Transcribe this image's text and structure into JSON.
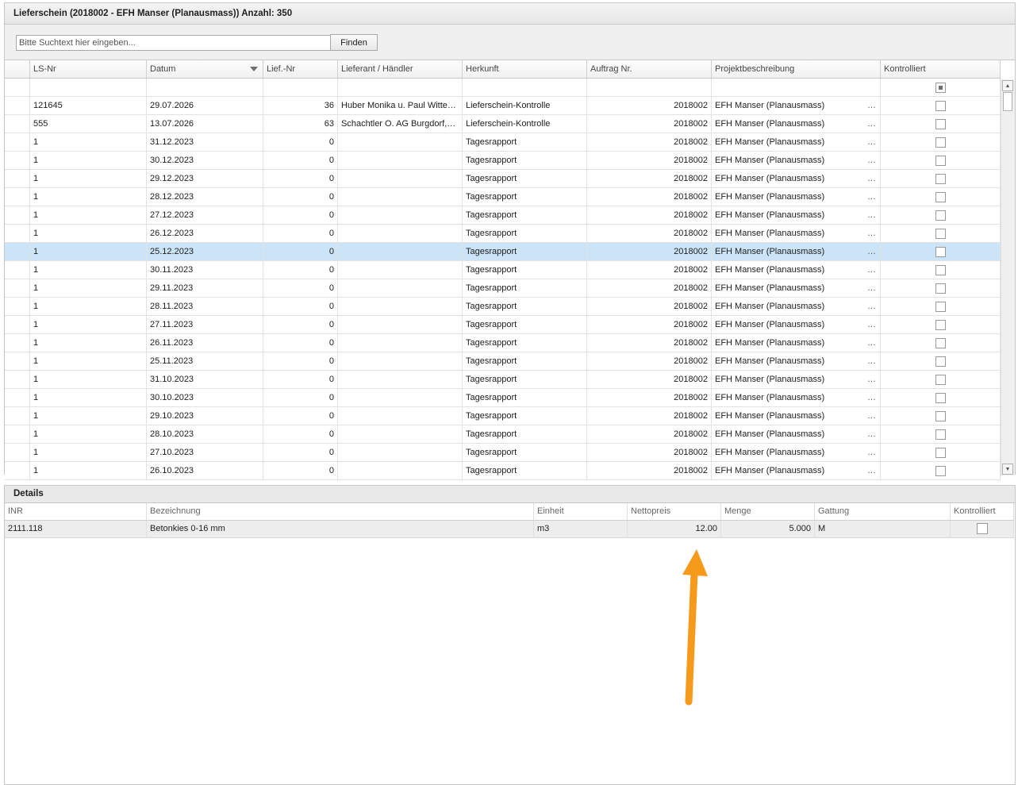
{
  "top_panel": {
    "title": "Lieferschein (2018002 - EFH Manser (Planausmass)) Anzahl: 350",
    "search_placeholder": "Bitte Suchtext hier eingeben...",
    "find_label": "Finden"
  },
  "grid": {
    "columns": [
      {
        "key": "indicator",
        "label": ""
      },
      {
        "key": "ls_nr",
        "label": "LS-Nr"
      },
      {
        "key": "datum",
        "label": "Datum",
        "sorted": "descending"
      },
      {
        "key": "lief_nr",
        "label": "Lief.-Nr"
      },
      {
        "key": "lieferant",
        "label": "Lieferant / Händler"
      },
      {
        "key": "herkunft",
        "label": "Herkunft"
      },
      {
        "key": "auftrag",
        "label": "Auftrag Nr."
      },
      {
        "key": "projekt",
        "label": "Projektbeschreibung"
      },
      {
        "key": "kontrolliert",
        "label": "Kontrolliert"
      }
    ],
    "filter_row_checkbox": "indeterminate",
    "selected_index": 8,
    "rows": [
      {
        "ls_nr": "121645",
        "datum": "29.07.2026",
        "lief_nr": "36",
        "lieferant": "Huber Monika u. Paul Witten...",
        "herkunft": "Lieferschein-Kontrolle",
        "auftrag": "2018002",
        "projekt": "EFH Manser (Planausmass)",
        "kontrolliert": false
      },
      {
        "ls_nr": "555",
        "datum": "13.07.2026",
        "lief_nr": "63",
        "lieferant": "Schachtler O. AG Burgdorf,Zi...",
        "herkunft": "Lieferschein-Kontrolle",
        "auftrag": "2018002",
        "projekt": "EFH Manser (Planausmass)",
        "kontrolliert": false
      },
      {
        "ls_nr": "1",
        "datum": "31.12.2023",
        "lief_nr": "0",
        "lieferant": "",
        "herkunft": "Tagesrapport",
        "auftrag": "2018002",
        "projekt": "EFH Manser (Planausmass)",
        "kontrolliert": false
      },
      {
        "ls_nr": "1",
        "datum": "30.12.2023",
        "lief_nr": "0",
        "lieferant": "",
        "herkunft": "Tagesrapport",
        "auftrag": "2018002",
        "projekt": "EFH Manser (Planausmass)",
        "kontrolliert": false
      },
      {
        "ls_nr": "1",
        "datum": "29.12.2023",
        "lief_nr": "0",
        "lieferant": "",
        "herkunft": "Tagesrapport",
        "auftrag": "2018002",
        "projekt": "EFH Manser (Planausmass)",
        "kontrolliert": false
      },
      {
        "ls_nr": "1",
        "datum": "28.12.2023",
        "lief_nr": "0",
        "lieferant": "",
        "herkunft": "Tagesrapport",
        "auftrag": "2018002",
        "projekt": "EFH Manser (Planausmass)",
        "kontrolliert": false
      },
      {
        "ls_nr": "1",
        "datum": "27.12.2023",
        "lief_nr": "0",
        "lieferant": "",
        "herkunft": "Tagesrapport",
        "auftrag": "2018002",
        "projekt": "EFH Manser (Planausmass)",
        "kontrolliert": false
      },
      {
        "ls_nr": "1",
        "datum": "26.12.2023",
        "lief_nr": "0",
        "lieferant": "",
        "herkunft": "Tagesrapport",
        "auftrag": "2018002",
        "projekt": "EFH Manser (Planausmass)",
        "kontrolliert": false
      },
      {
        "ls_nr": "1",
        "datum": "25.12.2023",
        "lief_nr": "0",
        "lieferant": "",
        "herkunft": "Tagesrapport",
        "auftrag": "2018002",
        "projekt": "EFH Manser (Planausmass)",
        "kontrolliert": false
      },
      {
        "ls_nr": "1",
        "datum": "30.11.2023",
        "lief_nr": "0",
        "lieferant": "",
        "herkunft": "Tagesrapport",
        "auftrag": "2018002",
        "projekt": "EFH Manser (Planausmass)",
        "kontrolliert": false
      },
      {
        "ls_nr": "1",
        "datum": "29.11.2023",
        "lief_nr": "0",
        "lieferant": "",
        "herkunft": "Tagesrapport",
        "auftrag": "2018002",
        "projekt": "EFH Manser (Planausmass)",
        "kontrolliert": false
      },
      {
        "ls_nr": "1",
        "datum": "28.11.2023",
        "lief_nr": "0",
        "lieferant": "",
        "herkunft": "Tagesrapport",
        "auftrag": "2018002",
        "projekt": "EFH Manser (Planausmass)",
        "kontrolliert": false
      },
      {
        "ls_nr": "1",
        "datum": "27.11.2023",
        "lief_nr": "0",
        "lieferant": "",
        "herkunft": "Tagesrapport",
        "auftrag": "2018002",
        "projekt": "EFH Manser (Planausmass)",
        "kontrolliert": false
      },
      {
        "ls_nr": "1",
        "datum": "26.11.2023",
        "lief_nr": "0",
        "lieferant": "",
        "herkunft": "Tagesrapport",
        "auftrag": "2018002",
        "projekt": "EFH Manser (Planausmass)",
        "kontrolliert": false
      },
      {
        "ls_nr": "1",
        "datum": "25.11.2023",
        "lief_nr": "0",
        "lieferant": "",
        "herkunft": "Tagesrapport",
        "auftrag": "2018002",
        "projekt": "EFH Manser (Planausmass)",
        "kontrolliert": false
      },
      {
        "ls_nr": "1",
        "datum": "31.10.2023",
        "lief_nr": "0",
        "lieferant": "",
        "herkunft": "Tagesrapport",
        "auftrag": "2018002",
        "projekt": "EFH Manser (Planausmass)",
        "kontrolliert": false
      },
      {
        "ls_nr": "1",
        "datum": "30.10.2023",
        "lief_nr": "0",
        "lieferant": "",
        "herkunft": "Tagesrapport",
        "auftrag": "2018002",
        "projekt": "EFH Manser (Planausmass)",
        "kontrolliert": false
      },
      {
        "ls_nr": "1",
        "datum": "29.10.2023",
        "lief_nr": "0",
        "lieferant": "",
        "herkunft": "Tagesrapport",
        "auftrag": "2018002",
        "projekt": "EFH Manser (Planausmass)",
        "kontrolliert": false
      },
      {
        "ls_nr": "1",
        "datum": "28.10.2023",
        "lief_nr": "0",
        "lieferant": "",
        "herkunft": "Tagesrapport",
        "auftrag": "2018002",
        "projekt": "EFH Manser (Planausmass)",
        "kontrolliert": false
      },
      {
        "ls_nr": "1",
        "datum": "27.10.2023",
        "lief_nr": "0",
        "lieferant": "",
        "herkunft": "Tagesrapport",
        "auftrag": "2018002",
        "projekt": "EFH Manser (Planausmass)",
        "kontrolliert": false
      },
      {
        "ls_nr": "1",
        "datum": "26.10.2023",
        "lief_nr": "0",
        "lieferant": "",
        "herkunft": "Tagesrapport",
        "auftrag": "2018002",
        "projekt": "EFH Manser (Planausmass)",
        "kontrolliert": false
      }
    ]
  },
  "details": {
    "title": "Details",
    "columns": [
      {
        "key": "inr",
        "label": "INR"
      },
      {
        "key": "bezeichnung",
        "label": "Bezeichnung"
      },
      {
        "key": "einheit",
        "label": "Einheit"
      },
      {
        "key": "nettopreis",
        "label": "Nettopreis"
      },
      {
        "key": "menge",
        "label": "Menge"
      },
      {
        "key": "gattung",
        "label": "Gattung"
      },
      {
        "key": "kontrolliert",
        "label": "Kontrolliert"
      }
    ],
    "rows": [
      {
        "inr": "2111.118",
        "bezeichnung": "Betonkies 0-16 mm",
        "einheit": "m3",
        "nettopreis": "12.00",
        "menge": "5.000",
        "gattung": "M",
        "kontrolliert": false
      }
    ]
  },
  "annotation": {
    "arrow_color": "#f59a1b",
    "target": "nettopreis"
  },
  "colors": {
    "selected_row": "#cce4f7",
    "panel_header": "#e9e9e9"
  }
}
